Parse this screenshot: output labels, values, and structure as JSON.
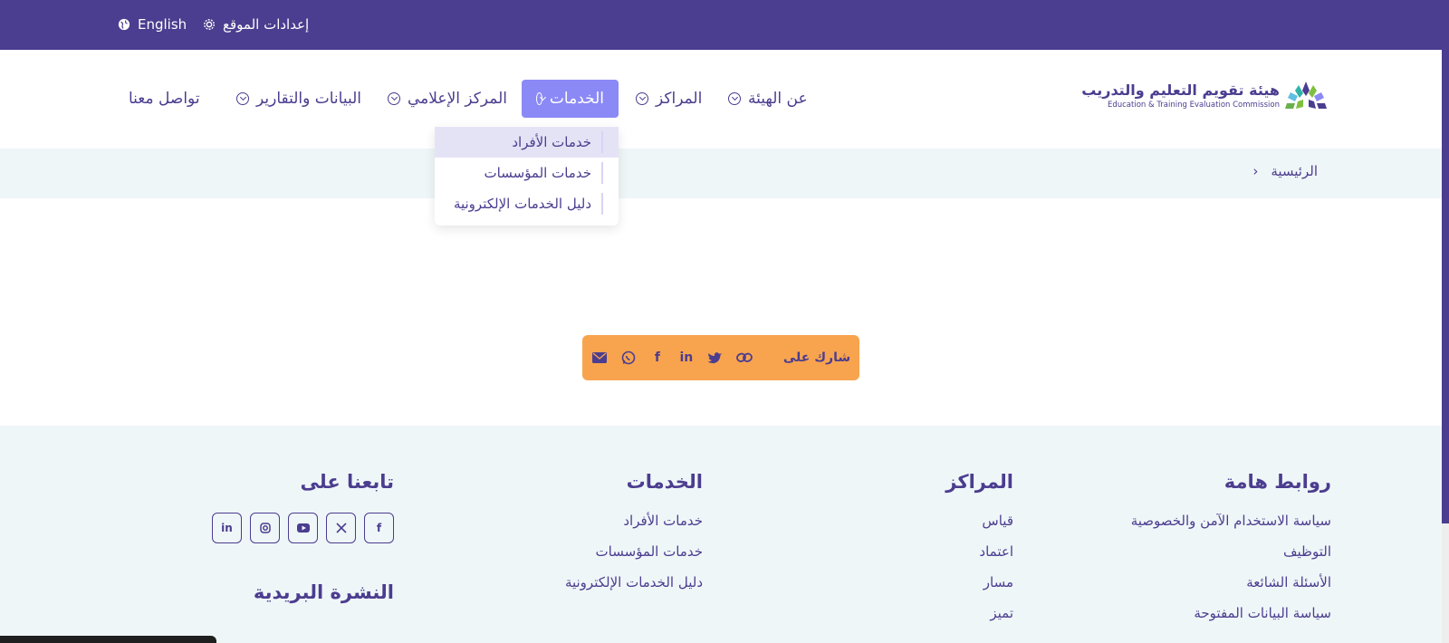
{
  "topbar": {
    "settings_label": "إعدادات الموقع",
    "language_label": "English",
    "bg_color": "#4b3d8f"
  },
  "header": {
    "logo_ar": "هيئة تقويم التعليم والتدريب",
    "logo_en": "Education & Training Evaluation Commission",
    "nav": {
      "about": "عن الهيئة",
      "centers": "المراكز",
      "services": "الخدمات",
      "media": "المركز الإعلامي",
      "data": "البيانات والتقارير",
      "contact": "تواصل معنا"
    },
    "active_color": "#8b89f5"
  },
  "dropdown": {
    "items": [
      "خدمات الأفراد",
      "خدمات المؤسسات",
      "دليل الخدمات الإلكترونية"
    ]
  },
  "breadcrumb": {
    "home": "الرئيسية",
    "separator": "›"
  },
  "share": {
    "label": "شارك على",
    "bg_color": "#f8a44e"
  },
  "footer": {
    "links": {
      "title": "روابط هامة",
      "items": [
        "سياسة الاستخدام الآمن والخصوصية",
        "التوظيف",
        "الأسئلة الشائعة",
        "سياسة البيانات المفتوحة"
      ]
    },
    "centers": {
      "title": "المراكز",
      "items": [
        "قياس",
        "اعتماد",
        "مسار",
        "تميز"
      ]
    },
    "services": {
      "title": "الخدمات",
      "items": [
        "خدمات الأفراد",
        "خدمات المؤسسات",
        "دليل الخدمات الإلكترونية"
      ]
    },
    "follow": {
      "title": "تابعنا على"
    },
    "newsletter_title": "النشرة البريدية"
  }
}
